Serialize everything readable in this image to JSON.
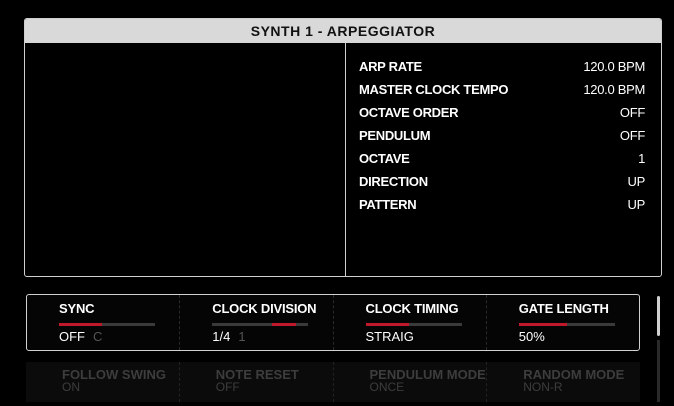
{
  "title": "SYNTH 1 - ARPEGGIATOR",
  "params": [
    {
      "name": "ARP RATE",
      "value": "120.0 BPM"
    },
    {
      "name": "MASTER CLOCK TEMPO",
      "value": "120.0 BPM"
    },
    {
      "name": "OCTAVE ORDER",
      "value": "OFF"
    },
    {
      "name": "PENDULUM",
      "value": "OFF"
    },
    {
      "name": "OCTAVE",
      "value": "1"
    },
    {
      "name": "DIRECTION",
      "value": "UP"
    },
    {
      "name": "PATTERN",
      "value": "UP"
    }
  ],
  "controls": [
    {
      "label": "SYNC",
      "value": "OFF",
      "ghost": "C",
      "level": 0.45
    },
    {
      "label": "CLOCK DIVISION",
      "value": "1/4",
      "ghost": "1",
      "level": 0.25
    },
    {
      "label": "CLOCK TIMING",
      "value": "STRAIG",
      "ghost": "",
      "level": 0.45
    },
    {
      "label": "GATE LENGTH",
      "value": "50%",
      "ghost": "",
      "level": 0.5
    }
  ],
  "controls_page2": [
    {
      "label": "FOLLOW SWING",
      "value": "ON"
    },
    {
      "label": "NOTE RESET",
      "value": "OFF"
    },
    {
      "label": "PENDULUM MODE",
      "value": "ONCE"
    },
    {
      "label": "RANDOM MODE",
      "value": "NON-R"
    }
  ],
  "colors": {
    "accent": "#c0192b",
    "title_bg": "#d9d9d9",
    "border": "#cfcfcf"
  }
}
